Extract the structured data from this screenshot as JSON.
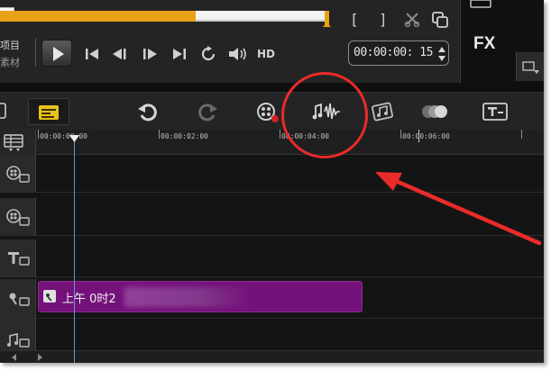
{
  "player": {
    "progress": 0.6,
    "mark_in_label": "[",
    "mark_out_label": "]",
    "mode_project_label": "项目",
    "mode_clip_label": "素材",
    "hd_label": "HD",
    "timecode": "00:00:00: 15"
  },
  "fx_panel": {
    "label": "FX"
  },
  "toolbar": {
    "items": [
      "timeline-view",
      "undo",
      "redo",
      "record-capture",
      "sound-mixer",
      "auto-music",
      "motion-tracking",
      "subtitle-editor"
    ]
  },
  "ruler": {
    "ticks": [
      "00:00:00:00",
      "00:00:02:00",
      "00:00:04:00",
      "00:00:06:00"
    ]
  },
  "tracks": [
    {
      "name": "video-track",
      "icon": "video-track-icon"
    },
    {
      "name": "overlay-track",
      "icon": "overlay-track-icon"
    },
    {
      "name": "title-track",
      "icon": "title-track-icon"
    },
    {
      "name": "voice-track",
      "icon": "voice-track-icon"
    },
    {
      "name": "music-track",
      "icon": "music-track-icon"
    }
  ],
  "clip": {
    "label": "上午 0时2"
  },
  "colors": {
    "accent_orange": "#e8a215",
    "clip_purple": "#74127a",
    "annotation_red": "#ea2b2b",
    "playhead_blue": "#5b9ad6",
    "timeline_view_button_yellow": "#e8c21a"
  }
}
